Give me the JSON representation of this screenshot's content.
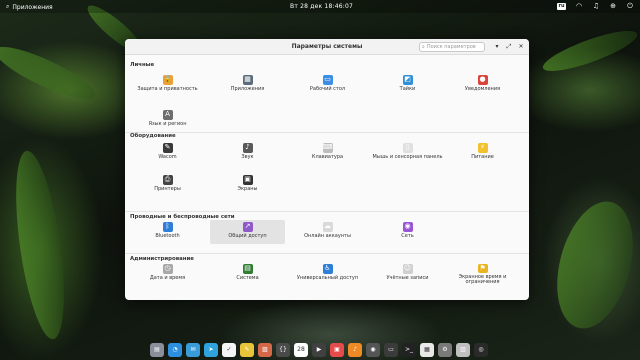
{
  "panel": {
    "apps_label": "Приложения",
    "clock": "Вт 28 дек 18:46:07",
    "tray_badge": "ru"
  },
  "window": {
    "title": "Параметры системы",
    "search_placeholder": "Поиск параметров"
  },
  "sections": {
    "personal": {
      "title": "Личные",
      "items": [
        {
          "label": "Защита и приватность",
          "icon": "lock-icon",
          "color": "#e9a23b"
        },
        {
          "label": "Приложения",
          "icon": "apps-icon",
          "color": "#5b6b7c"
        },
        {
          "label": "Рабочий стол",
          "icon": "desktop-icon",
          "color": "#3c8ee5"
        },
        {
          "label": "Тайки",
          "icon": "tiles-icon",
          "color": "#2f8fd8"
        },
        {
          "label": "Уведомления",
          "icon": "notifications-icon",
          "color": "#d8453b"
        },
        {
          "label": "Язык и регион",
          "icon": "language-icon",
          "color": "#6d6d6d"
        }
      ]
    },
    "hardware": {
      "title": "Оборудование",
      "items": [
        {
          "label": "Wacom",
          "icon": "tablet-icon",
          "color": "#3a3a3a"
        },
        {
          "label": "Звук",
          "icon": "speaker-icon",
          "color": "#5a5a5a"
        },
        {
          "label": "Клавиатура",
          "icon": "keyboard-icon",
          "color": "#bdbdbd"
        },
        {
          "label": "Мышь и сенсорная панель",
          "icon": "mouse-icon",
          "color": "#e0e0e0"
        },
        {
          "label": "Питание",
          "icon": "power-icon",
          "color": "#f2c12e"
        },
        {
          "label": "Принтеры",
          "icon": "printer-icon",
          "color": "#444444"
        },
        {
          "label": "Экраны",
          "icon": "display-icon",
          "color": "#333333"
        }
      ]
    },
    "network": {
      "title": "Проводные и беспроводные сети",
      "items": [
        {
          "label": "Bluetooth",
          "icon": "bluetooth-icon",
          "color": "#2f7fd8"
        },
        {
          "label": "Общий доступ",
          "icon": "sharing-icon",
          "color": "#8e5bc9"
        },
        {
          "label": "Онлайн аккаунты",
          "icon": "cloud-icon",
          "color": "#d9d9d9"
        },
        {
          "label": "Сеть",
          "icon": "network-icon",
          "color": "#9a55d6"
        }
      ]
    },
    "admin": {
      "title": "Администрирование",
      "items": [
        {
          "label": "Дата и время",
          "icon": "clock-icon",
          "color": "#a8a8a8"
        },
        {
          "label": "Система",
          "icon": "system-icon",
          "color": "#2e7d32"
        },
        {
          "label": "Универсальный доступ",
          "icon": "accessibility-icon",
          "color": "#2f7fd8"
        },
        {
          "label": "Учётные записи",
          "icon": "users-icon",
          "color": "#cfcfcf"
        },
        {
          "label": "Экранное время и ограничения",
          "icon": "parental-icon",
          "color": "#e8b422"
        }
      ]
    }
  },
  "dock": [
    {
      "name": "files-icon",
      "color": "#8a8f99"
    },
    {
      "name": "browser-icon",
      "color": "#2d8fe0"
    },
    {
      "name": "mail-icon",
      "color": "#3a9bd9"
    },
    {
      "name": "telegram-icon",
      "color": "#2fa3dd"
    },
    {
      "name": "tasks-icon",
      "color": "#f5f5f5"
    },
    {
      "name": "notes-icon",
      "color": "#e8c43a"
    },
    {
      "name": "photos-icon",
      "color": "#d6684a"
    },
    {
      "name": "code-icon",
      "color": "#4a4a4a"
    },
    {
      "name": "calendar-icon",
      "color": "#ffffff"
    },
    {
      "name": "video-icon",
      "color": "#404040"
    },
    {
      "name": "appcenter-icon",
      "color": "#e54b4b"
    },
    {
      "name": "music-icon",
      "color": "#f08a24"
    },
    {
      "name": "camera-icon",
      "color": "#555555"
    },
    {
      "name": "monitor-icon",
      "color": "#3b3b3b"
    },
    {
      "name": "terminal-icon",
      "color": "#222222"
    },
    {
      "name": "documents-icon",
      "color": "#e9e9e9"
    },
    {
      "name": "settings-icon",
      "color": "#7a7a7a"
    },
    {
      "name": "trash-icon",
      "color": "#c0c0c0"
    },
    {
      "name": "obs-icon",
      "color": "#2a2a2a"
    }
  ]
}
